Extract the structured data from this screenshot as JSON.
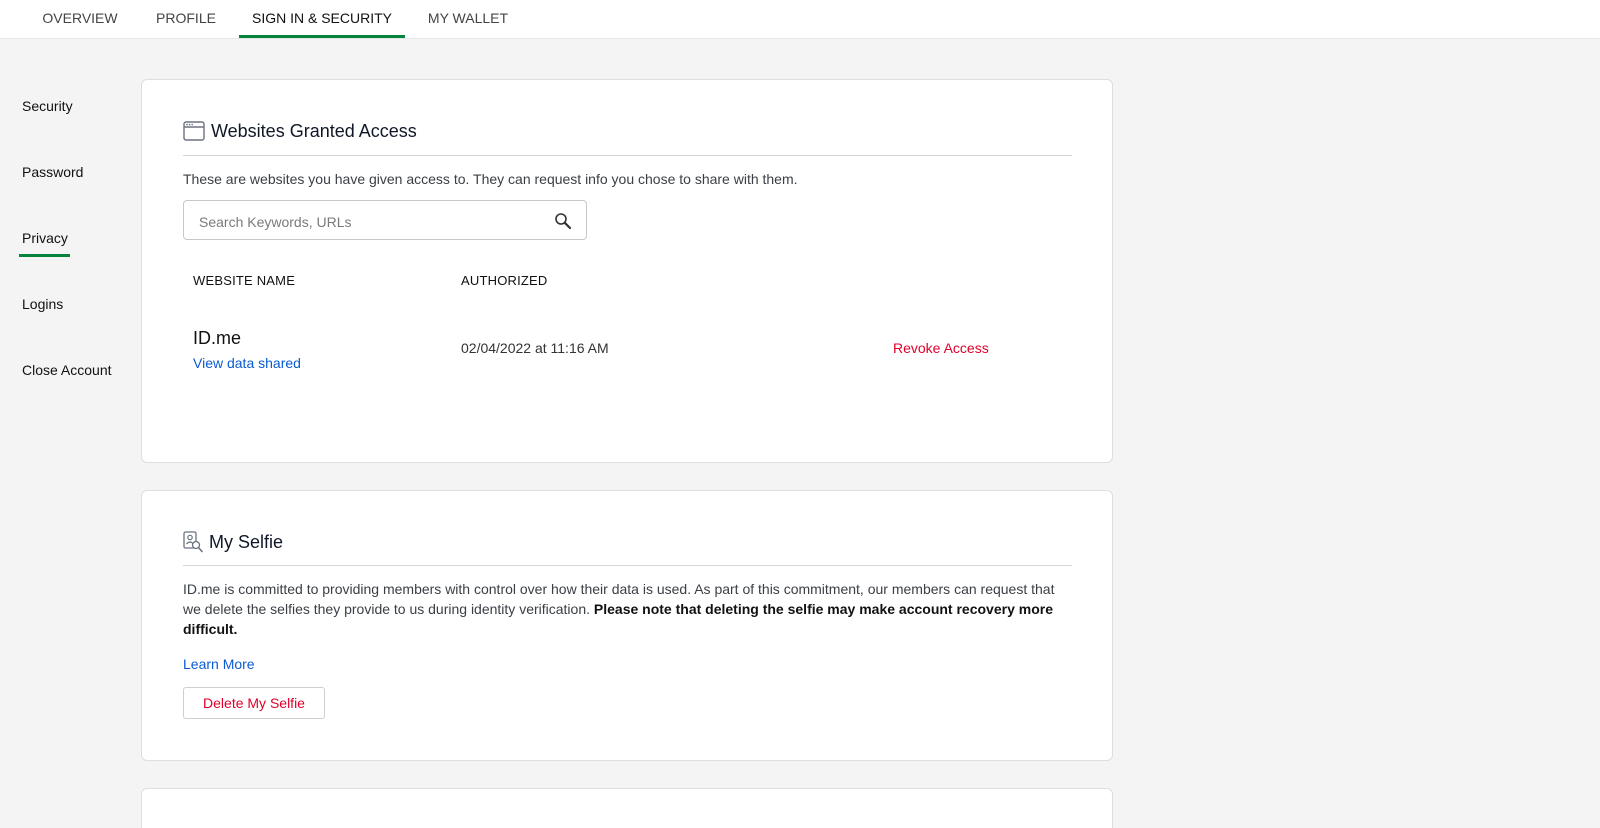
{
  "tabs": [
    {
      "label": "OVERVIEW"
    },
    {
      "label": "PROFILE"
    },
    {
      "label": "SIGN IN & SECURITY",
      "active": true
    },
    {
      "label": "MY WALLET"
    }
  ],
  "sidebar": {
    "items": [
      {
        "label": "Security"
      },
      {
        "label": "Password"
      },
      {
        "label": "Privacy",
        "active": true
      },
      {
        "label": "Logins"
      },
      {
        "label": "Close Account"
      }
    ]
  },
  "websites": {
    "icon": "browser-window-icon",
    "title": "Websites Granted Access",
    "description": "These are websites you have given access to. They can request info you chose to share with them.",
    "search_placeholder": "Search Keywords, URLs",
    "search_value": "",
    "columns": {
      "name": "WEBSITE NAME",
      "authorized": "AUTHORIZED"
    },
    "rows": [
      {
        "name": "ID.me",
        "view_link": "View data shared",
        "authorized": "02/04/2022 at 11:16 AM",
        "action": "Revoke Access"
      }
    ]
  },
  "selfie": {
    "icon": "selfie-id-icon",
    "title": "My Selfie",
    "description": "ID.me is committed to providing members with control over how their data is used. As part of this commitment, our members can request that we delete the selfies they provide to us during identity verification.",
    "description_bold": "Please note that deleting the selfie may make account recovery more difficult.",
    "learn_more": "Learn More",
    "delete_button": "Delete My Selfie"
  },
  "colors": {
    "accent_green": "#08833d",
    "link_blue": "#0b5bd3",
    "danger_red": "#e0002b",
    "page_bg": "#f4f4f4"
  }
}
